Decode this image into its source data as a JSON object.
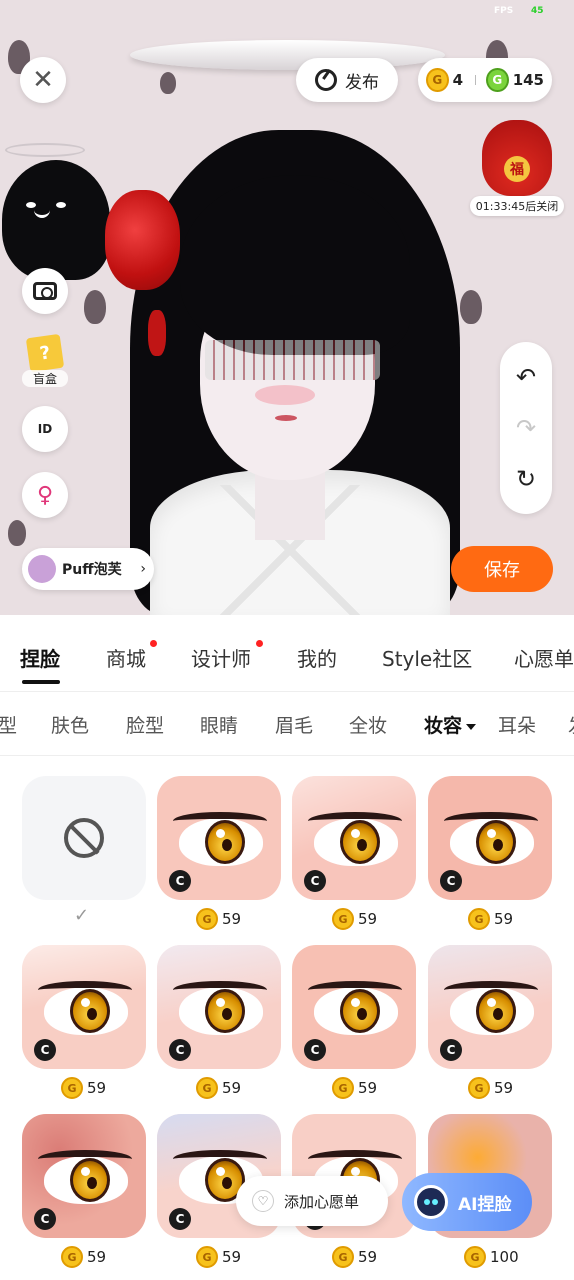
{
  "status": {
    "fps_label": "FPS",
    "fps_value": "45"
  },
  "top": {
    "publish_label": "发布",
    "gold_coins": "4",
    "green_coins": "145",
    "coin_symbol": "G"
  },
  "promo": {
    "timer": "01:33:45后关闭",
    "badge": "福"
  },
  "side": {
    "blindbox_label": "盲盒",
    "id_label": "ID"
  },
  "creator": {
    "name": "Puff泡芙"
  },
  "save_label": "保存",
  "tabs": [
    {
      "label": "捏脸",
      "active": true
    },
    {
      "label": "商城",
      "dot": true
    },
    {
      "label": "设计师",
      "dot": true
    },
    {
      "label": "我的"
    },
    {
      "label": "Style社区"
    },
    {
      "label": "心愿单"
    }
  ],
  "subtabs": [
    "型",
    "肤色",
    "脸型",
    "眼睛",
    "眉毛",
    "全妆",
    "妆容",
    "耳朵",
    "发"
  ],
  "items": [
    {
      "type": "none"
    },
    {
      "price": "59"
    },
    {
      "price": "59"
    },
    {
      "price": "59"
    },
    {
      "price": "59"
    },
    {
      "price": "59"
    },
    {
      "price": "59"
    },
    {
      "price": "59"
    },
    {
      "price": "59"
    },
    {
      "price": "59"
    },
    {
      "price": "59"
    },
    {
      "price": "100"
    }
  ],
  "check_mark": "✓",
  "c_badge": "C",
  "floating": {
    "wishlist_label": "添加心愿单",
    "ai_label": "AI捏脸"
  },
  "colors": {
    "accent": "#ff6a12",
    "tile_bg": "#f8c7bc",
    "ai_gradient_start": "#8fb8ff",
    "ai_gradient_end": "#5c8ef7"
  }
}
